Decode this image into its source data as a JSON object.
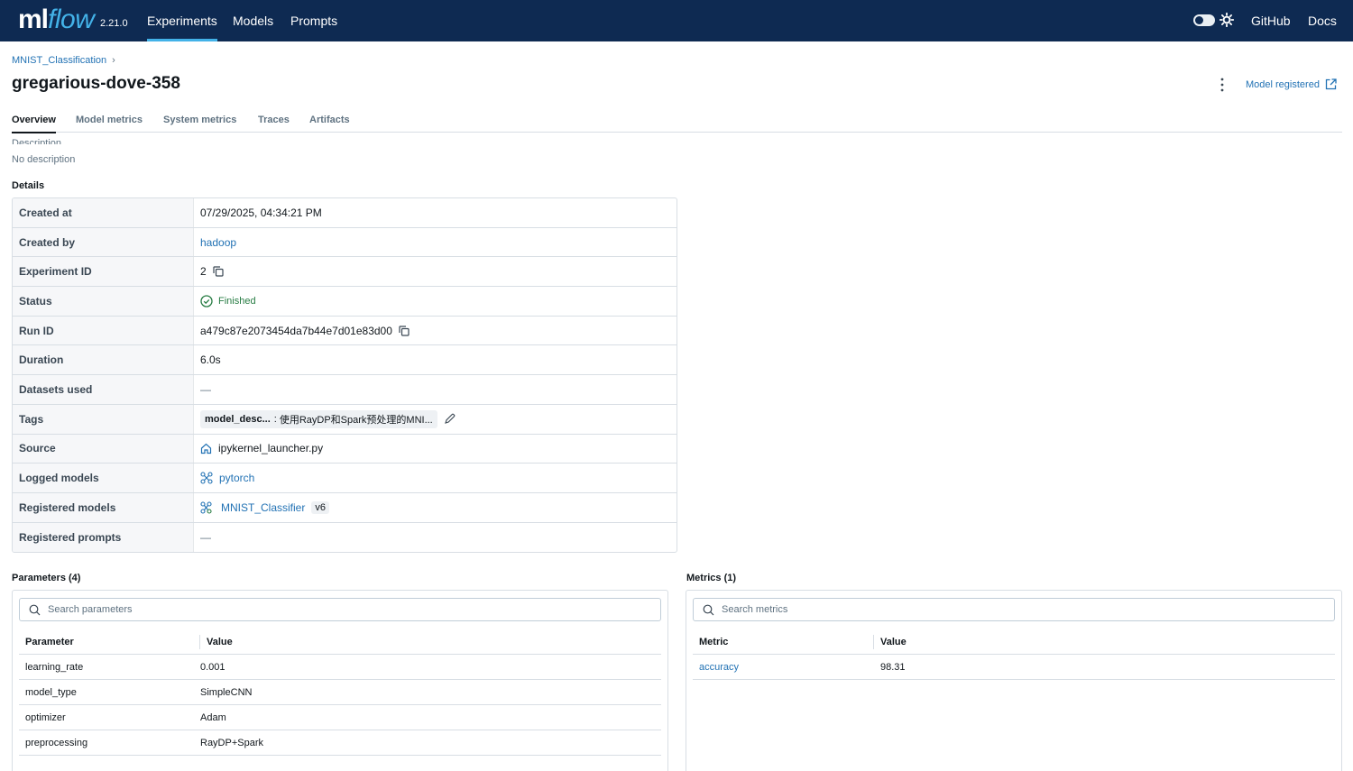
{
  "nav": {
    "logo_ml": "ml",
    "logo_flow": "flow",
    "version": "2.21.0",
    "links": [
      "Experiments",
      "Models",
      "Prompts"
    ],
    "active_link": "Experiments",
    "right_links": [
      "GitHub",
      "Docs"
    ]
  },
  "header": {
    "breadcrumb": "MNIST_Classification",
    "breadcrumb_sep": "›",
    "title": "gregarious-dove-358",
    "model_registered": "Model registered"
  },
  "tabs": [
    "Overview",
    "Model metrics",
    "System metrics",
    "Traces",
    "Artifacts"
  ],
  "active_tab": "Overview",
  "description": {
    "cut_label": "Description",
    "text": "No description"
  },
  "details": {
    "label": "Details",
    "created_at": {
      "key": "Created at",
      "value": "07/29/2025, 04:34:21 PM"
    },
    "created_by": {
      "key": "Created by",
      "value": "hadoop"
    },
    "experiment_id": {
      "key": "Experiment ID",
      "value": "2"
    },
    "status": {
      "key": "Status",
      "value": "Finished"
    },
    "run_id": {
      "key": "Run ID",
      "value": "a479c87e2073454da7b44e7d01e83d00"
    },
    "duration": {
      "key": "Duration",
      "value": "6.0s"
    },
    "datasets_used": {
      "key": "Datasets used",
      "value": "—"
    },
    "tags": {
      "key": "Tags",
      "tag_key": "model_desc...",
      "tag_value": "使用RayDP和Spark预处理的MNI..."
    },
    "source": {
      "key": "Source",
      "value": "ipykernel_launcher.py"
    },
    "logged_models": {
      "key": "Logged models",
      "value": "pytorch"
    },
    "registered_models": {
      "key": "Registered models",
      "value": "MNIST_Classifier",
      "version": "v6"
    },
    "registered_prompts": {
      "key": "Registered prompts",
      "value": "—"
    }
  },
  "parameters": {
    "label": "Parameters (4)",
    "search_placeholder": "Search parameters",
    "col_param": "Parameter",
    "col_value": "Value",
    "rows": [
      {
        "name": "learning_rate",
        "value": "0.001"
      },
      {
        "name": "model_type",
        "value": "SimpleCNN"
      },
      {
        "name": "optimizer",
        "value": "Adam"
      },
      {
        "name": "preprocessing",
        "value": "RayDP+Spark"
      }
    ]
  },
  "metrics": {
    "label": "Metrics (1)",
    "search_placeholder": "Search metrics",
    "col_metric": "Metric",
    "col_value": "Value",
    "rows": [
      {
        "name": "accuracy",
        "value": "98.31"
      }
    ]
  },
  "colors": {
    "nav_bg": "#0e2a52",
    "accent": "#43b2e8",
    "link": "#2272b4",
    "success": "#277c43"
  }
}
